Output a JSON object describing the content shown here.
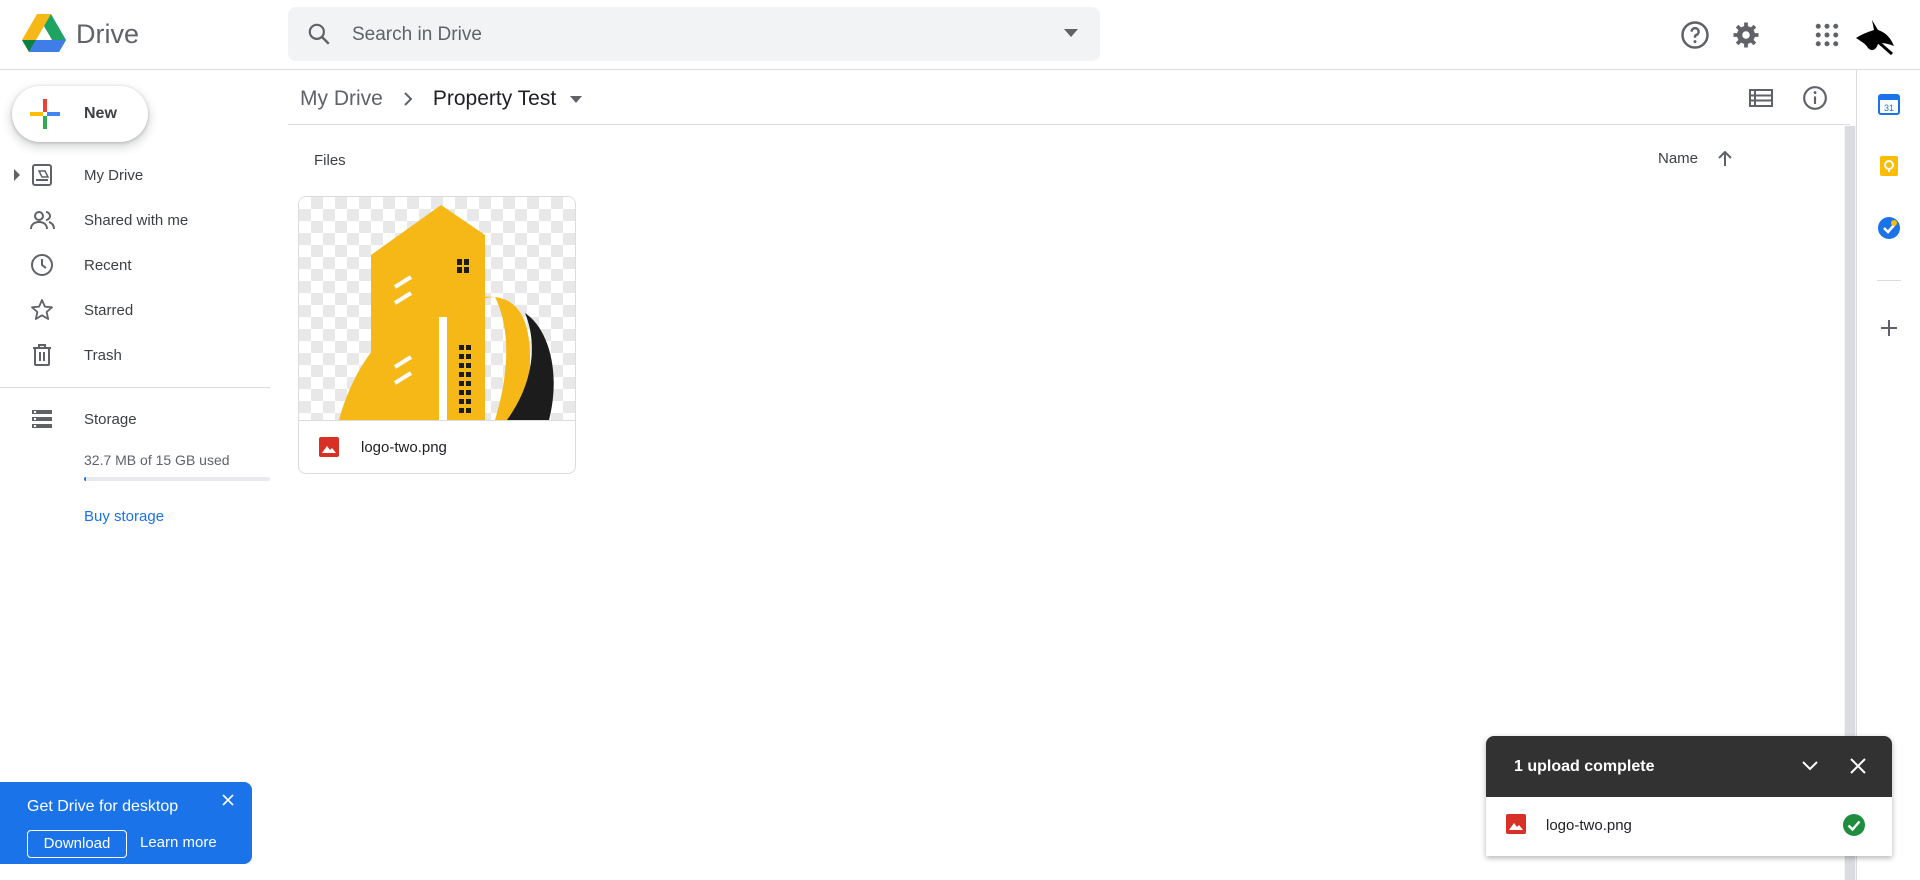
{
  "app": {
    "name": "Drive"
  },
  "search": {
    "placeholder": "Search in Drive"
  },
  "sidebar": {
    "new_label": "New",
    "items": [
      {
        "label": "My Drive"
      },
      {
        "label": "Shared with me"
      },
      {
        "label": "Recent"
      },
      {
        "label": "Starred"
      },
      {
        "label": "Trash"
      }
    ],
    "storage": {
      "label": "Storage",
      "used_text": "32.7 MB of 15 GB used",
      "used_fraction": 0.002,
      "buy_label": "Buy storage"
    }
  },
  "breadcrumb": {
    "root": "My Drive",
    "current": "Property Test"
  },
  "main": {
    "section_label": "Files",
    "sort_label": "Name",
    "files": [
      {
        "name": "logo-two.png"
      }
    ]
  },
  "promo": {
    "title": "Get Drive for desktop",
    "download_label": "Download",
    "learn_more_label": "Learn more"
  },
  "upload_panel": {
    "title": "1 upload complete",
    "items": [
      {
        "name": "logo-two.png"
      }
    ]
  },
  "colors": {
    "accent": "#1a73e8",
    "logo_yellow": "#f6b817",
    "success": "#1e8e3e",
    "image_file_red": "#d93025"
  },
  "icons": {
    "header": [
      "search-icon",
      "chevron-down-icon",
      "help-icon",
      "gear-icon",
      "apps-icon",
      "avatar"
    ],
    "right_panel": [
      "calendar-icon",
      "keep-icon",
      "tasks-icon",
      "add-icon"
    ]
  }
}
